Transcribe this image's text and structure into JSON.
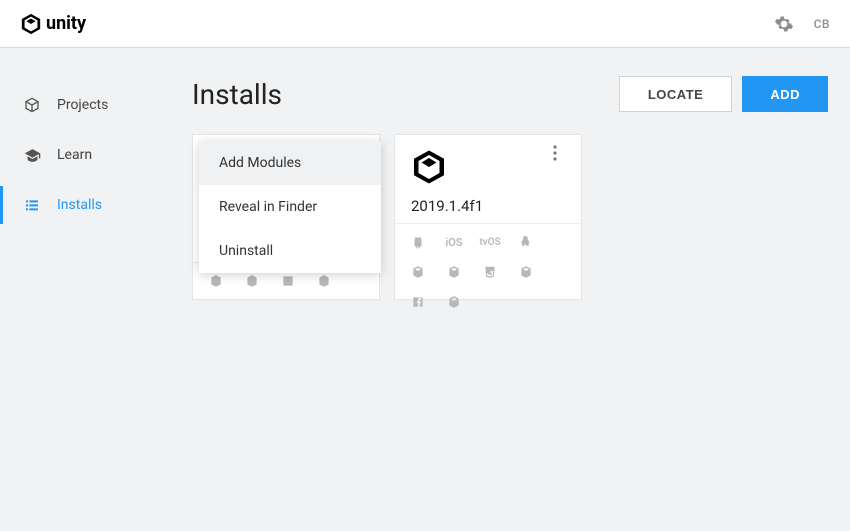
{
  "brand": "unity",
  "user_initials": "CB",
  "sidebar": {
    "items": [
      {
        "label": "Projects"
      },
      {
        "label": "Learn"
      },
      {
        "label": "Installs"
      }
    ]
  },
  "page": {
    "title": "Installs",
    "locate_label": "LOCATE",
    "add_label": "ADD"
  },
  "context_menu": {
    "add_modules": "Add Modules",
    "reveal": "Reveal in Finder",
    "uninstall": "Uninstall"
  },
  "installs": [
    {
      "version": "2019.1.4f1"
    }
  ],
  "platforms": {
    "ios": "iOS",
    "tvos": "tvOS"
  }
}
